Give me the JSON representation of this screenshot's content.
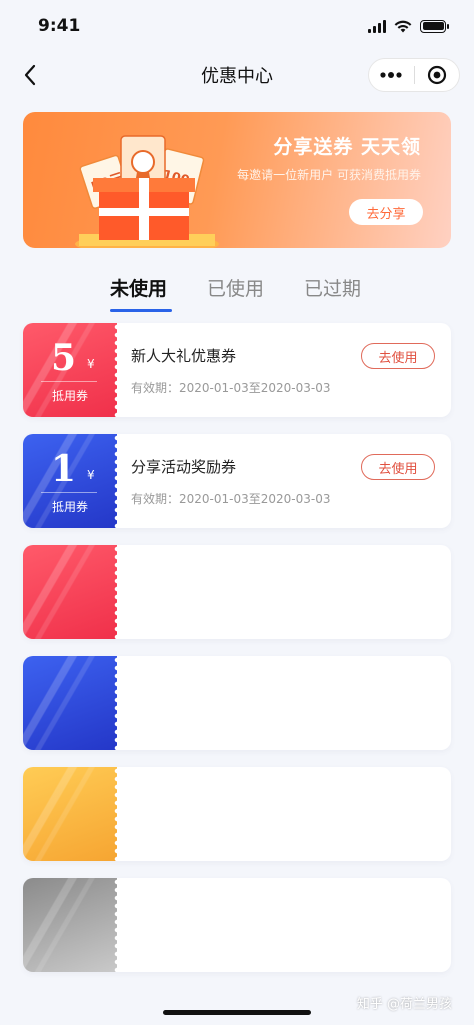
{
  "status_bar": {
    "time": "9:41"
  },
  "nav": {
    "title": "优惠中心"
  },
  "banner": {
    "title": "分享送券 天天领",
    "subtitle": "每邀请一位新用户 可获消费抵用券",
    "share_button": "去分享",
    "gift_tags": [
      "50元",
      "100"
    ]
  },
  "tabs": [
    {
      "label": "未使用",
      "active": true
    },
    {
      "label": "已使用",
      "active": false
    },
    {
      "label": "已过期",
      "active": false
    }
  ],
  "coupons": [
    {
      "value": "5",
      "currency": "¥",
      "unit_label": "抵用券",
      "name": "新人大礼优惠券",
      "validity": "有效期：2020-01-03至2020-03-03",
      "action": "去使用",
      "color": "#f0304a"
    },
    {
      "value": "1",
      "currency": "¥",
      "unit_label": "抵用券",
      "name": "分享活动奖励券",
      "validity": "有效期：2020-01-03至2020-03-03",
      "action": "去使用",
      "color": "#2437c8"
    }
  ],
  "placeholder_colors": [
    "#f0304a",
    "#2437c8",
    "#f6a532",
    "#8b8b8b"
  ],
  "watermark": "知乎 @荷兰男孩"
}
